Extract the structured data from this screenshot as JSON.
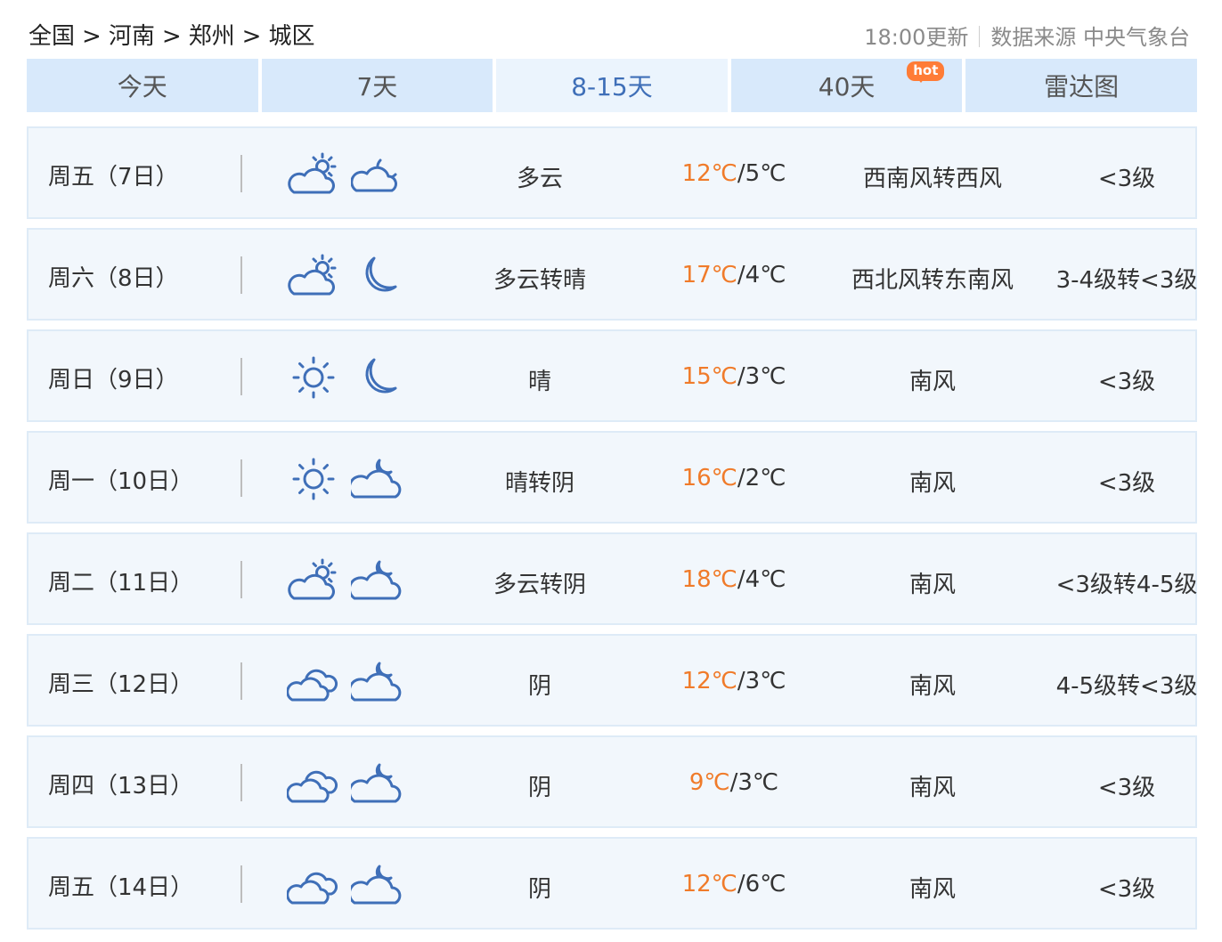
{
  "breadcrumb": {
    "items": [
      "全国",
      "河南",
      "郑州",
      "城区"
    ],
    "separator": ">"
  },
  "meta": {
    "update_time": "18:00更新",
    "source": "数据来源 中央气象台"
  },
  "tabs": [
    {
      "label": "今天",
      "active": false
    },
    {
      "label": "7天",
      "active": false
    },
    {
      "label": "8-15天",
      "active": true
    },
    {
      "label": "40天",
      "active": false,
      "badge": "hot"
    },
    {
      "label": "雷达图",
      "active": false
    }
  ],
  "colors": {
    "tab_bg": "#d8e9fb",
    "tab_active_bg": "#ebf4fd",
    "tab_active_text": "#3f6fb8",
    "high_temp": "#f07b2a",
    "icon": "#3f6fb8",
    "hot_badge": "#ff7c36"
  },
  "days": [
    {
      "day": "周五（7日）",
      "icon_day": "partly-cloudy-day-icon",
      "icon_night": "partly-cloudy-night-icon",
      "desc": "多云",
      "high": "12℃",
      "low": "/5℃",
      "wind": "西南风转西风",
      "level": "<3级"
    },
    {
      "day": "周六（8日）",
      "icon_day": "partly-cloudy-day-icon",
      "icon_night": "moon-icon",
      "desc": "多云转晴",
      "high": "17℃",
      "low": "/4℃",
      "wind": "西北风转东南风",
      "level": "3-4级转<3级"
    },
    {
      "day": "周日（9日）",
      "icon_day": "sun-icon",
      "icon_night": "moon-icon",
      "desc": "晴",
      "high": "15℃",
      "low": "/3℃",
      "wind": "南风",
      "level": "<3级"
    },
    {
      "day": "周一（10日）",
      "icon_day": "sun-icon",
      "icon_night": "overcast-night-icon",
      "desc": "晴转阴",
      "high": "16℃",
      "low": "/2℃",
      "wind": "南风",
      "level": "<3级"
    },
    {
      "day": "周二（11日）",
      "icon_day": "partly-cloudy-day-icon",
      "icon_night": "overcast-night-icon",
      "desc": "多云转阴",
      "high": "18℃",
      "low": "/4℃",
      "wind": "南风",
      "level": "<3级转4-5级"
    },
    {
      "day": "周三（12日）",
      "icon_day": "overcast-icon",
      "icon_night": "overcast-night-icon",
      "desc": "阴",
      "high": "12℃",
      "low": "/3℃",
      "wind": "南风",
      "level": "4-5级转<3级"
    },
    {
      "day": "周四（13日）",
      "icon_day": "overcast-icon",
      "icon_night": "overcast-night-icon",
      "desc": "阴",
      "high": "9℃",
      "low": "/3℃",
      "wind": "南风",
      "level": "<3级"
    },
    {
      "day": "周五（14日）",
      "icon_day": "overcast-icon",
      "icon_night": "overcast-night-icon",
      "desc": "阴",
      "high": "12℃",
      "low": "/6℃",
      "wind": "南风",
      "level": "<3级"
    }
  ]
}
